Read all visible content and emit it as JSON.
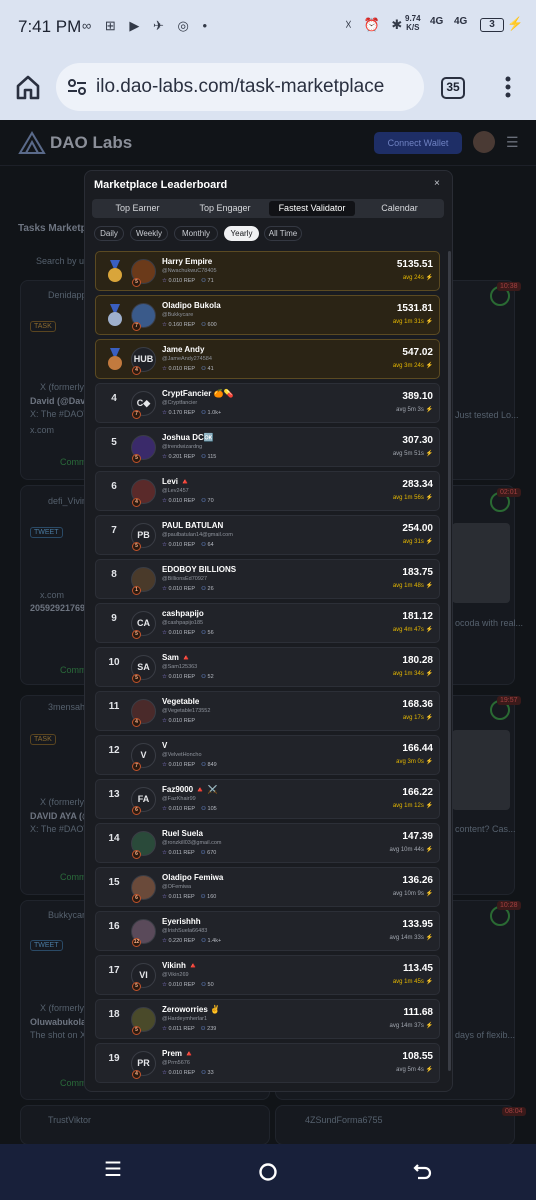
{
  "status_bar": {
    "time": "7:41 PM",
    "net_speed": "9.74",
    "net_unit": "K/S",
    "signal_1": "4G",
    "signal_2": "4G",
    "battery": "3"
  },
  "browser": {
    "url": "ilo.dao-labs.com/task-marketplace",
    "tab_count": "35"
  },
  "site": {
    "logo_text": "DAO Labs",
    "connect_label": "Connect Wallet",
    "section_title": "Tasks Marketp",
    "search_placeholder": "Search by u",
    "bg_snippets": [
      "Denidapps",
      "TASK",
      "X (formerly T",
      "David (@Davi",
      "X: The #DAOVER",
      "x.com",
      "Comme",
      "defi_Vivin",
      "TWEET",
      "x.com",
      "2059292176979",
      "Comme",
      "3mensahC",
      "TASK",
      "X (formerly T",
      "DAVID AYA (@",
      "X: The #DAOVER",
      "Comm",
      "Bukkycare",
      "TWEET",
      "X (formerly T",
      "Oluwabukola",
      "The shot on X s",
      "Comm",
      "TrustViktor",
      "4ZSundForma6755",
      "Just tested Lo...",
      "ocoda with real...",
      "content? Cas...",
      "days of flexib...",
      "10:38",
      "02:01",
      "19:57",
      "10:28",
      "08:04"
    ]
  },
  "modal": {
    "title": "Marketplace Leaderboard",
    "close_label": "×",
    "tabs": [
      "Top Earner",
      "Top Engager",
      "Fastest Validator",
      "Calendar"
    ],
    "active_tab": 2,
    "periods": [
      "Daily",
      "Weekly",
      "Monthly",
      "Yearly",
      "All Time"
    ],
    "active_period": 3,
    "rows": [
      {
        "rank": "1",
        "name": "Harry Empire",
        "handle": "@NwachukwuC78405",
        "rep": "0.010 REP",
        "followers": "71",
        "score": "5135.51",
        "avg": "avg 24s",
        "fast": true,
        "initials": "",
        "level": "5",
        "medal": "gold"
      },
      {
        "rank": "2",
        "name": "Oladipo Bukola",
        "handle": "@Bukkycare",
        "rep": "0.160 REP",
        "followers": "600",
        "score": "1531.81",
        "avg": "avg 1m 31s",
        "fast": true,
        "initials": "",
        "level": "7",
        "medal": "silver"
      },
      {
        "rank": "3",
        "name": "Jame Andy",
        "handle": "@JameAndy274584",
        "rep": "0.010 REP",
        "followers": "41",
        "score": "547.02",
        "avg": "avg 3m 24s",
        "fast": true,
        "initials": "HUB",
        "level": "4",
        "medal": "bronze"
      },
      {
        "rank": "4",
        "name": "CryptFancier 🍊💊",
        "handle": "@Cryptfancier",
        "rep": "0.170 REP",
        "followers": "1.0k+",
        "score": "389.10",
        "avg": "avg 5m 3s",
        "fast": false,
        "initials": "C◆",
        "level": "7",
        "medal": ""
      },
      {
        "rank": "5",
        "name": "Joshua DC🆗",
        "handle": "@trendwizardng",
        "rep": "0.201 REP",
        "followers": "115",
        "score": "307.30",
        "avg": "avg 5m 51s",
        "fast": false,
        "initials": "",
        "level": "5",
        "medal": ""
      },
      {
        "rank": "6",
        "name": "Levi 🔺",
        "handle": "@Lev2457",
        "rep": "0.010 REP",
        "followers": "70",
        "score": "283.34",
        "avg": "avg 1m 56s",
        "fast": true,
        "initials": "",
        "level": "4",
        "medal": ""
      },
      {
        "rank": "7",
        "name": "PAUL BATULAN",
        "handle": "@paulbatulan14@gmail.com",
        "rep": "0.010 REP",
        "followers": "64",
        "score": "254.00",
        "avg": "avg 31s",
        "fast": true,
        "initials": "PB",
        "level": "5",
        "medal": ""
      },
      {
        "rank": "8",
        "name": "EDOBOY BILLIONS",
        "handle": "@BillionsEd70927",
        "rep": "0.010 REP",
        "followers": "26",
        "score": "183.75",
        "avg": "avg 1m 48s",
        "fast": true,
        "initials": "",
        "level": "1",
        "medal": ""
      },
      {
        "rank": "9",
        "name": "cashpapijo",
        "handle": "@cashpapijo185",
        "rep": "0.010 REP",
        "followers": "56",
        "score": "181.12",
        "avg": "avg 4m 47s",
        "fast": true,
        "initials": "CA",
        "level": "5",
        "medal": ""
      },
      {
        "rank": "10",
        "name": "Sam 🔺",
        "handle": "@Sam125363",
        "rep": "0.010 REP",
        "followers": "52",
        "score": "180.28",
        "avg": "avg 1m 34s",
        "fast": true,
        "initials": "SA",
        "level": "5",
        "medal": ""
      },
      {
        "rank": "11",
        "name": "Vegetable",
        "handle": "@Vegetable173552",
        "rep": "0.010 REP",
        "followers": "",
        "score": "168.36",
        "avg": "avg 17s",
        "fast": true,
        "initials": "",
        "level": "4",
        "medal": ""
      },
      {
        "rank": "12",
        "name": "V",
        "handle": "@VelvetHoncho",
        "rep": "0.010 REP",
        "followers": "849",
        "score": "166.44",
        "avg": "avg 3m 0s",
        "fast": true,
        "initials": "V",
        "level": "7",
        "medal": ""
      },
      {
        "rank": "13",
        "name": "Faz9000 🔺 ⚔️",
        "handle": "@FazKhair99",
        "rep": "0.010 REP",
        "followers": "105",
        "score": "166.22",
        "avg": "avg 1m 12s",
        "fast": true,
        "initials": "FA",
        "level": "6",
        "medal": ""
      },
      {
        "rank": "14",
        "name": "Ruel Suela",
        "handle": "@ronzkill03@gmail.com",
        "rep": "0.011 REP",
        "followers": "670",
        "score": "147.39",
        "avg": "avg 10m 44s",
        "fast": false,
        "initials": "",
        "level": "6",
        "medal": ""
      },
      {
        "rank": "15",
        "name": "Oladipo Femiwa",
        "handle": "@OFemiwa",
        "rep": "0.011 REP",
        "followers": "160",
        "score": "136.26",
        "avg": "avg 10m 9s",
        "fast": false,
        "initials": "",
        "level": "6",
        "medal": ""
      },
      {
        "rank": "16",
        "name": "Eyerishhh",
        "handle": "@IrishSuela66483",
        "rep": "0.220 REP",
        "followers": "1.4k+",
        "score": "133.95",
        "avg": "avg 14m 33s",
        "fast": false,
        "initials": "",
        "level": "12",
        "medal": ""
      },
      {
        "rank": "17",
        "name": "Vikinh 🔺",
        "handle": "@Vikin269",
        "rep": "0.010 REP",
        "followers": "50",
        "score": "113.45",
        "avg": "avg 1m 45s",
        "fast": true,
        "initials": "VI",
        "level": "5",
        "medal": ""
      },
      {
        "rank": "18",
        "name": "Zeroworries ✌️",
        "handle": "@Hardeymherlar1",
        "rep": "0.011 REP",
        "followers": "239",
        "score": "111.68",
        "avg": "avg 14m 37s",
        "fast": false,
        "initials": "",
        "level": "5",
        "medal": ""
      },
      {
        "rank": "19",
        "name": "Prem 🔺",
        "handle": "@Prm5676",
        "rep": "0.010 REP",
        "followers": "33",
        "score": "108.55",
        "avg": "avg 5m 4s",
        "fast": false,
        "initials": "PR",
        "level": "4",
        "medal": ""
      }
    ]
  },
  "colors": {
    "gold_row": "#2b2415",
    "fast_avg": "#e6b800",
    "active_tab_bg": "#111216"
  },
  "icons": {
    "nav": [
      "recents-icon",
      "home-icon",
      "back-icon"
    ]
  }
}
